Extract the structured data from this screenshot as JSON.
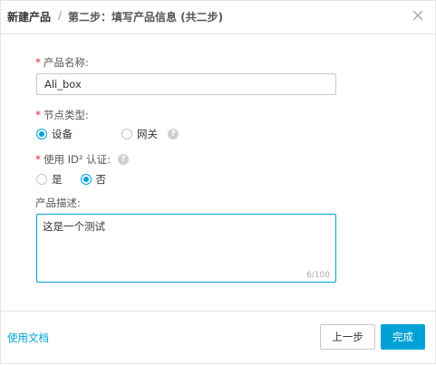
{
  "header": {
    "title": "新建产品",
    "separator": "/",
    "step": "第二步：填写产品信息 (共二步)",
    "close_icon": "close-icon"
  },
  "form": {
    "product_name": {
      "required_mark": "*",
      "label": "产品名称:",
      "value": "Ali_box"
    },
    "node_type": {
      "required_mark": "*",
      "label": "节点类型:",
      "options": [
        "设备",
        "网关"
      ],
      "selected": "设备",
      "help_icon": "question-icon"
    },
    "use_id2": {
      "required_mark": "*",
      "label": "使用 ID² 认证:",
      "options": [
        "是",
        "否"
      ],
      "selected": "否",
      "help_icon": "question-icon"
    },
    "description": {
      "label": "产品描述:",
      "value": "这是一个测试",
      "char_count": "6/100"
    }
  },
  "footer": {
    "doc_link": "使用文档",
    "prev_button": "上一步",
    "done_button": "完成"
  },
  "colors": {
    "accent": "#00a1d6",
    "required": "#e0252b",
    "border": "#c8c8c8"
  }
}
